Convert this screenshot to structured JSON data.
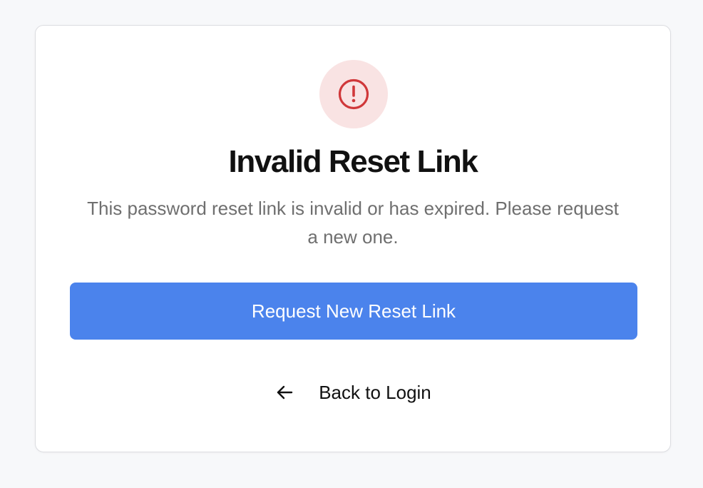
{
  "card": {
    "title": "Invalid Reset Link",
    "message": "This password reset link is invalid or has expired. Please request a new one.",
    "icon": "alert-circle-icon",
    "primary_button_label": "Request New Reset Link",
    "back_link_label": "Back to Login",
    "back_icon": "arrow-left-icon"
  },
  "colors": {
    "accent": "#4b83ec",
    "error": "#d0383a",
    "error_bg": "#f9e3e3",
    "background": "#f7f8fa"
  }
}
